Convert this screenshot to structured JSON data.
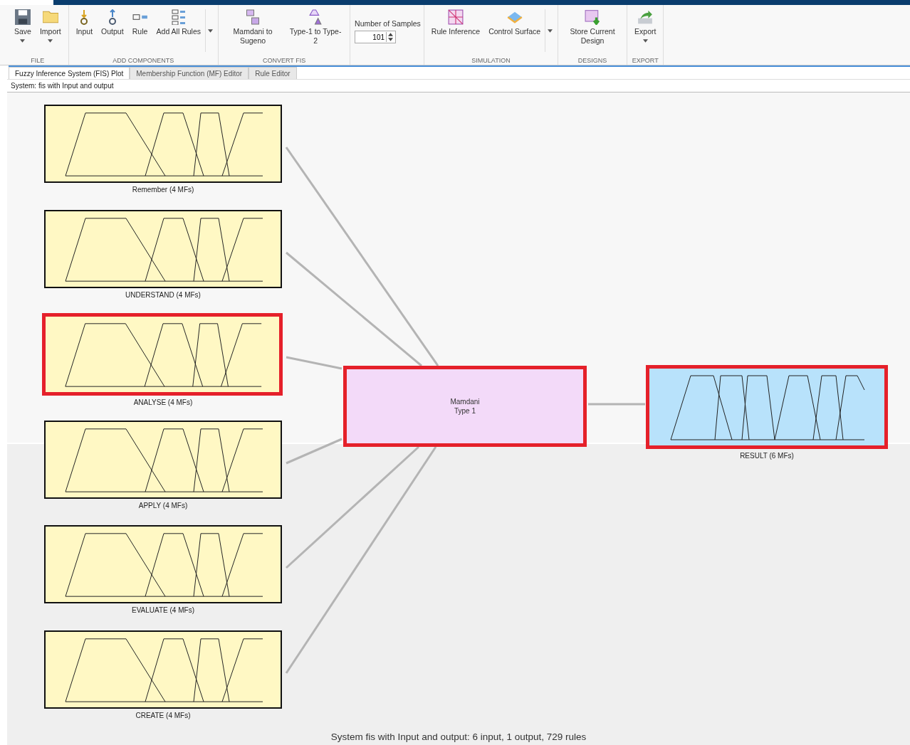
{
  "toolbar": {
    "groups": [
      {
        "label": "FILE",
        "items": [
          {
            "kind": "button",
            "label": "Save",
            "dropdown": true
          },
          {
            "kind": "button",
            "label": "Import",
            "dropdown": true
          }
        ],
        "more": false
      },
      {
        "label": "ADD COMPONENTS",
        "items": [
          {
            "kind": "button",
            "label": "Input",
            "dropdown": false
          },
          {
            "kind": "button",
            "label": "Output",
            "dropdown": false
          },
          {
            "kind": "button",
            "label": "Rule",
            "dropdown": false
          },
          {
            "kind": "button",
            "label": "Add All Rules",
            "dropdown": false
          }
        ],
        "more": true
      },
      {
        "label": "CONVERT FIS",
        "items": [
          {
            "kind": "button",
            "label": "Mamdani to Sugeno",
            "dropdown": false
          },
          {
            "kind": "button",
            "label": "Type-1 to Type-2",
            "dropdown": false
          }
        ],
        "more": false
      },
      {
        "items": [
          {
            "kind": "spinner",
            "label": "Number of Samples",
            "value": "101"
          }
        ],
        "more": false
      },
      {
        "label": "SIMULATION",
        "items": [
          {
            "kind": "button",
            "label": "Rule Inference",
            "dropdown": false
          },
          {
            "kind": "button",
            "label": "Control Surface",
            "dropdown": false
          }
        ],
        "more": true
      },
      {
        "label": "DESIGNS",
        "items": [
          {
            "kind": "button",
            "label": "Store Current Design",
            "dropdown": false
          }
        ],
        "more": false
      },
      {
        "label": "EXPORT",
        "items": [
          {
            "kind": "button",
            "label": "Export",
            "dropdown": true
          }
        ],
        "more": false
      }
    ]
  },
  "tabs": [
    {
      "label": "Fuzzy Inference System (FIS) Plot",
      "selected": true
    },
    {
      "label": "Membership Function (MF) Editor",
      "selected": false
    },
    {
      "label": "Rule Editor",
      "selected": false
    }
  ],
  "system_label": "System: fis with Input and output",
  "inputs": [
    {
      "label": "Remember (4 MFs)",
      "highlighted": false
    },
    {
      "label": "UNDERSTAND (4 MFs)",
      "highlighted": false
    },
    {
      "label": "ANALYSE (4 MFs)",
      "highlighted": true
    },
    {
      "label": "APPLY (4 MFs)",
      "highlighted": false
    },
    {
      "label": "EVALUATE (4 MFs)",
      "highlighted": false
    },
    {
      "label": "CREATE (4 MFs)",
      "highlighted": false
    }
  ],
  "engine": {
    "lines": [
      "Mamdani",
      "Type 1"
    ],
    "highlighted": true
  },
  "outputs": [
    {
      "label": "RESULT (6 MFs)",
      "highlighted": true
    }
  ],
  "status": "System fis with Input and output: 6 input, 1 output, 729 rules"
}
